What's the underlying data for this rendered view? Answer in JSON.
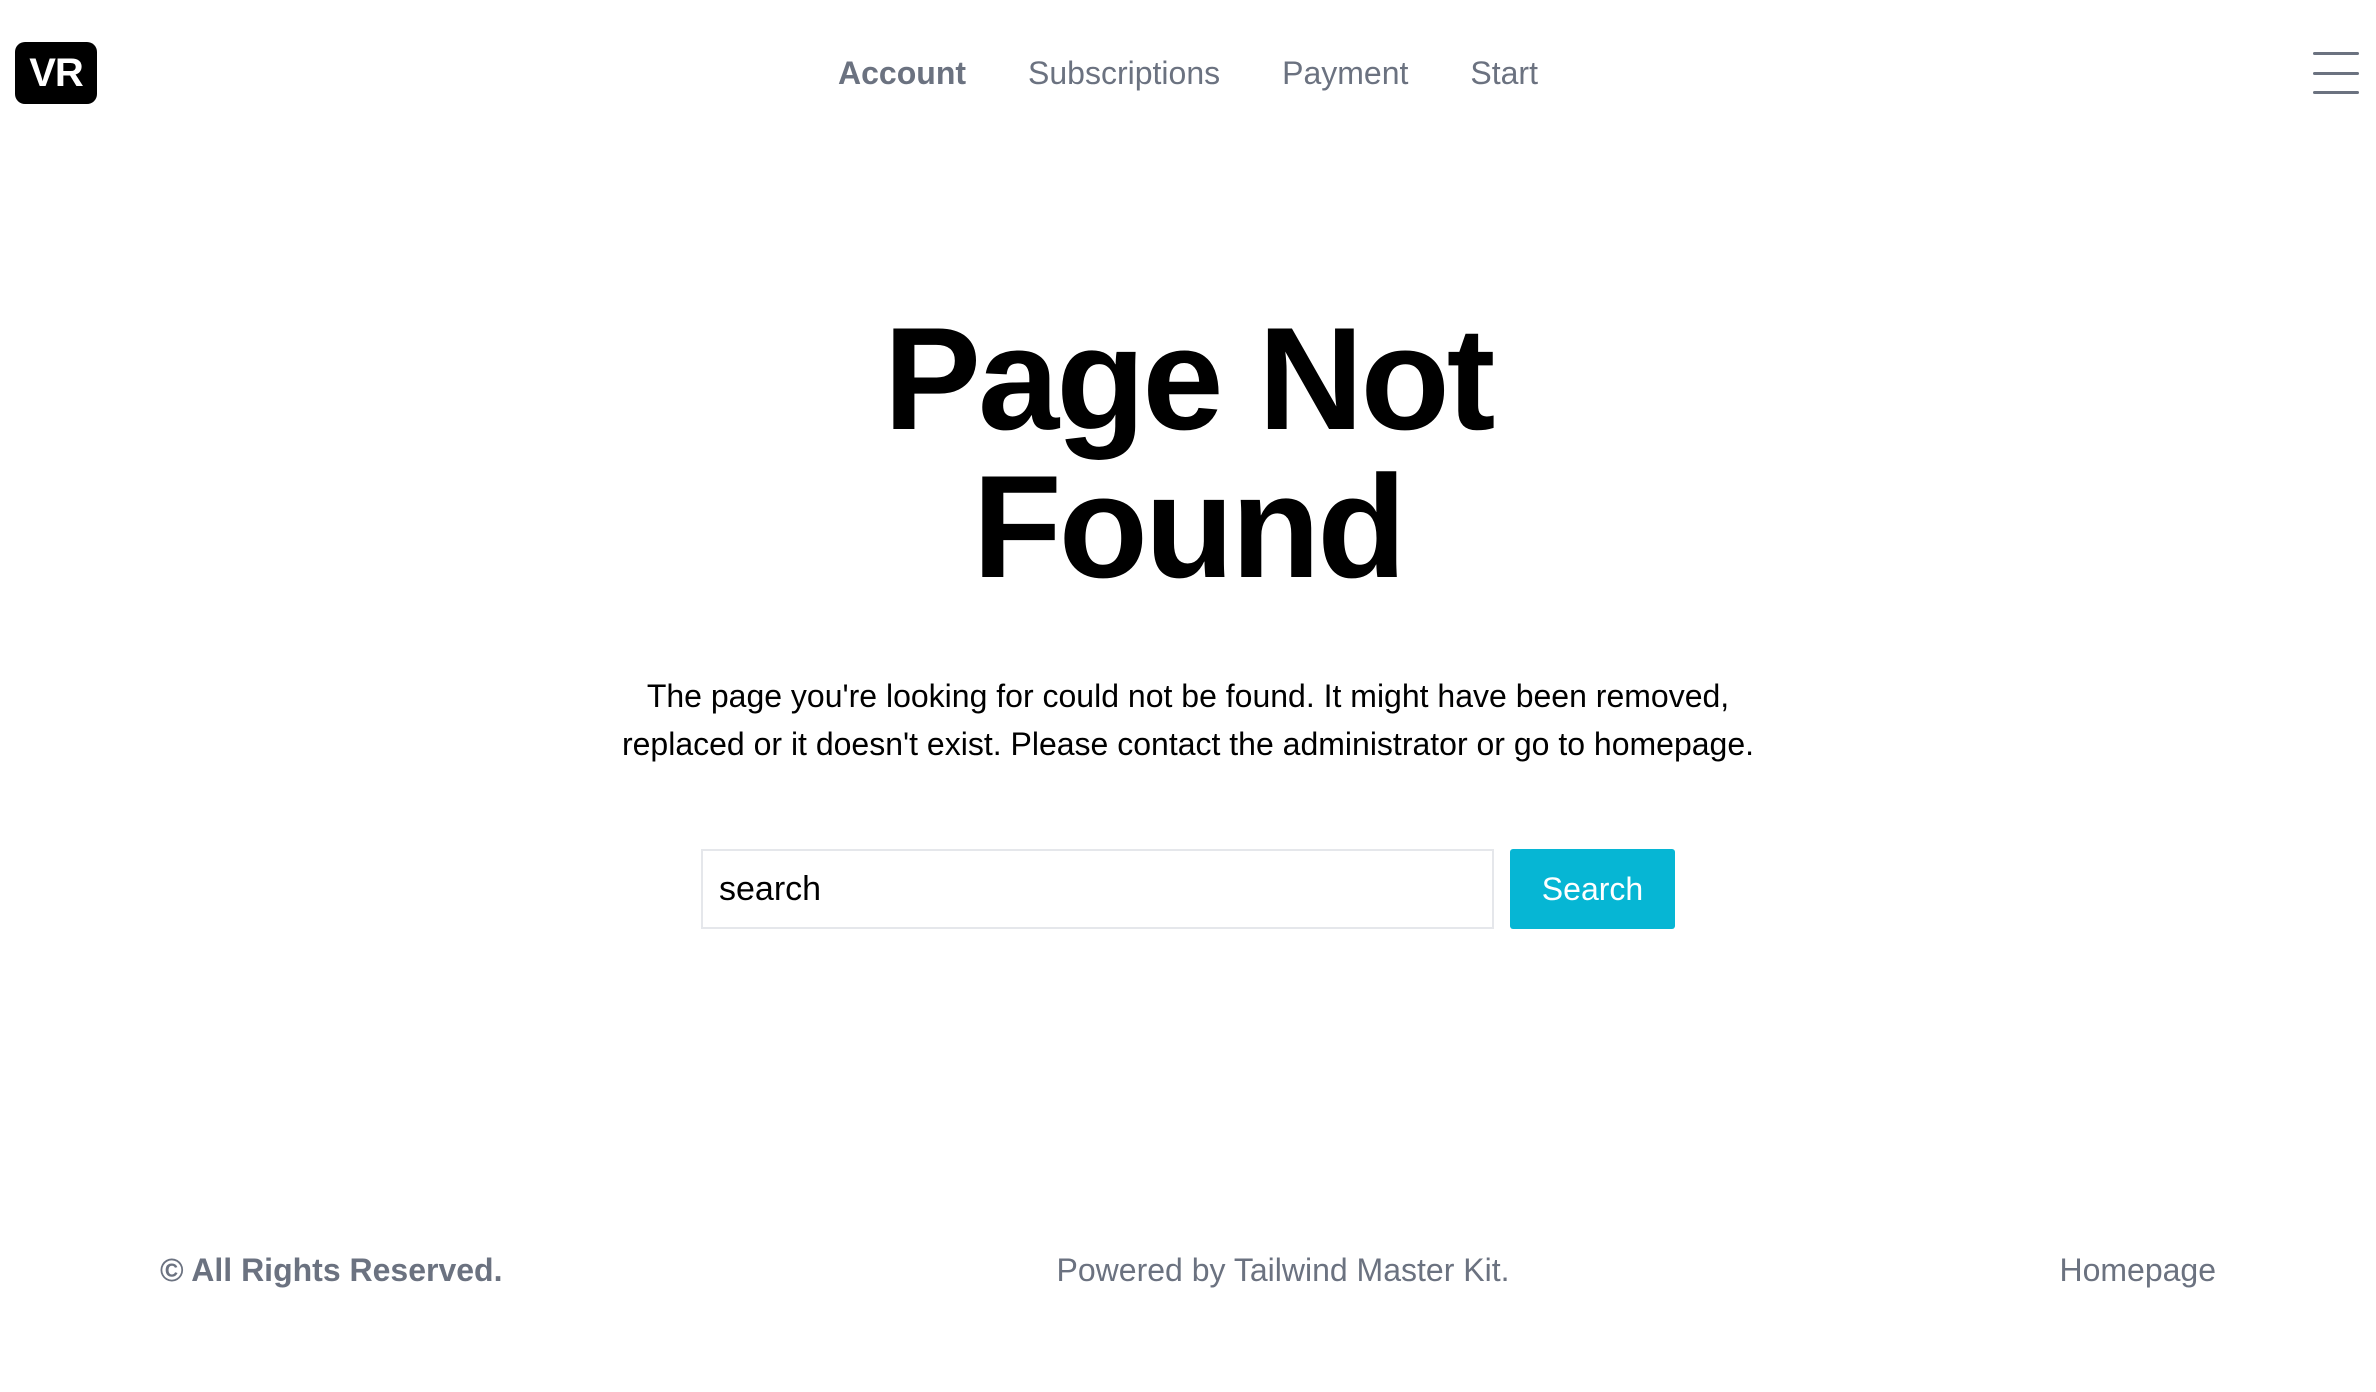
{
  "header": {
    "logo_text": "VR",
    "nav": [
      {
        "label": "Account",
        "active": true
      },
      {
        "label": "Subscriptions",
        "active": false
      },
      {
        "label": "Payment",
        "active": false
      },
      {
        "label": "Start",
        "active": false
      }
    ],
    "menu_icon": "hamburger-menu-icon"
  },
  "main": {
    "title_line1": "Page Not",
    "title_line2": "Found",
    "description": "The page you're looking for could not be found. It might have been removed, replaced or it doesn't exist. Please contact the administrator or go to homepage.",
    "search": {
      "placeholder": "search",
      "value": "",
      "button_label": "Search",
      "button_color": "#06b6d4"
    }
  },
  "footer": {
    "rights": "© All Rights Reserved.",
    "powered": "Powered by Tailwind Master Kit.",
    "homepage_link": "Homepage"
  },
  "colors": {
    "nav_text": "#6b7280",
    "accent": "#06b6d4",
    "logo_bg": "#000000"
  }
}
